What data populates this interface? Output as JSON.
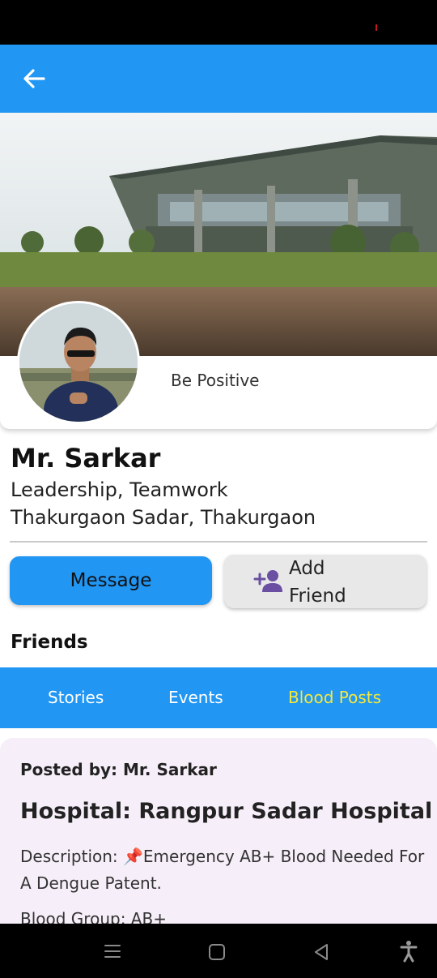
{
  "header": {
    "back_icon": "arrow-left-icon"
  },
  "profile": {
    "motto": "Be Positive",
    "name": "Mr. Sarkar",
    "skills": "Leadership, Teamwork",
    "location": "Thakurgaon Sadar, Thakurgaon"
  },
  "actions": {
    "message_label": "Message",
    "add_friend_line1": "Add",
    "add_friend_line2": "Friend",
    "add_friend_icon": "person-add-icon"
  },
  "friends": {
    "title": "Friends"
  },
  "tabs": [
    {
      "label": "Stories",
      "active": false
    },
    {
      "label": "Events",
      "active": false
    },
    {
      "label": "Blood Posts",
      "active": true
    }
  ],
  "post": {
    "posted_by": "Posted by: Mr. Sarkar",
    "hospital": "Hospital: Rangpur Sadar Hospital",
    "description": "Description: 📌Emergency AB+ Blood Needed For A Dengue Patent.",
    "blood_group": "Blood Group: AB+"
  },
  "colors": {
    "primary": "#2196f3",
    "active_tab": "#f5e93a",
    "card_bg": "#f6eef8",
    "add_icon": "#6a4fa3"
  },
  "system_nav": [
    "menu-icon",
    "home-icon",
    "back-triangle-icon",
    "accessibility-icon"
  ]
}
